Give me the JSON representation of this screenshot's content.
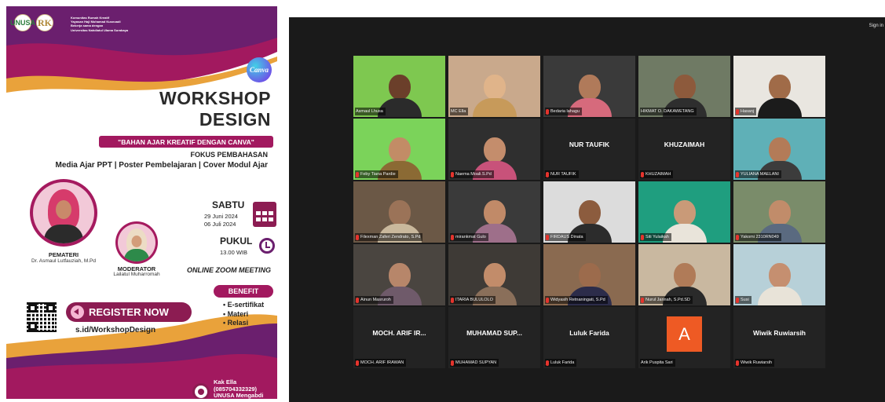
{
  "poster": {
    "logos": [
      "UNUSA",
      "RK"
    ],
    "org_lines": [
      "Komunitas Rumah Kreatif",
      "Yayasan Haji Mohamad Kusnoadi",
      "Bekerja sama dengan",
      "Universitas Nahdlatul Ulama Surabaya"
    ],
    "canva_badge": "Canva",
    "title_line1": "WORKSHOP",
    "title_line2": "DESIGN",
    "subtitle": "\"BAHAN AJAR KREATIF DENGAN CANVA\"",
    "fokus_label": "FOKUS PEMBAHASAN",
    "topics": "Media Ajar PPT | Poster Pembelajaran | Cover Modul Ajar",
    "pemateri_role": "PEMATERI",
    "pemateri_name": "Dr. Asmaul Lutfauziah, M.Pd",
    "moderator_role": "MODERATOR",
    "moderator_name": "Lailatul Muharromah",
    "day": "SABTU",
    "date1": "29 Juni 2024",
    "date2": "06 Juli 2024",
    "pukul_label": "PUKUL",
    "time": "13.00 WIB",
    "meeting": "ONLINE ZOOM MEETING",
    "benefit_label": "BENEFIT",
    "benefits": [
      "• E-sertifikat",
      "• Materi",
      "• Relasi"
    ],
    "register_label": "REGISTER NOW",
    "register_link": "s.id/WorkshopDesign",
    "contact_name": "Kak Ella",
    "contact_phone": "(085704332329)",
    "contact_org": "UNUSA Mengabdi",
    "colors": {
      "magenta": "#a2195f",
      "purple": "#6b1f6e",
      "dark_magenta": "#8c1c52"
    }
  },
  "zoom": {
    "sign_in": "Sign in",
    "participants": [
      {
        "name": "Asmaul Lhusa",
        "muted": false,
        "big_name": "",
        "bg": "#7ec850",
        "skin": "#6b3f2a",
        "cloth": "#2b2b2b",
        "active": false
      },
      {
        "name": "MC Ella",
        "muted": false,
        "big_name": "",
        "bg": "#c9a98c",
        "skin": "#e0b48a",
        "cloth": "#c79a5a",
        "active": true
      },
      {
        "name": "Bedaria lahagu",
        "muted": true,
        "big_name": "",
        "bg": "#3a3a3a",
        "skin": "#b07a5a",
        "cloth": "#d66a7c",
        "active": false
      },
      {
        "name": "HIKMAT O. DAKAWETANG",
        "muted": false,
        "big_name": "",
        "bg": "#6f7a64",
        "skin": "#8d5a3c",
        "cloth": "#2e2e2e",
        "active": false
      },
      {
        "name": "Hasanj",
        "muted": true,
        "big_name": "",
        "bg": "#e9e6e0",
        "skin": "#a06b48",
        "cloth": "#1b1b1b",
        "active": false
      },
      {
        "name": "Feby Tiana Pardie",
        "muted": true,
        "big_name": "",
        "bg": "#7bd35a",
        "skin": "#c28c66",
        "cloth": "#8b6a34",
        "active": false
      },
      {
        "name": "Naema Moali.S.Pd",
        "muted": true,
        "big_name": "",
        "bg": "#2f2f2f",
        "skin": "#c48d6c",
        "cloth": "#c8527a",
        "active": false
      },
      {
        "name": "NUR TAUFIK",
        "muted": true,
        "big_name": "NUR TAUFIK",
        "bg": "#232323",
        "skin": "",
        "cloth": "",
        "active": false
      },
      {
        "name": "KHUZAIMAH",
        "muted": true,
        "big_name": "KHUZAIMAH",
        "bg": "#232323",
        "skin": "",
        "cloth": "",
        "active": false
      },
      {
        "name": "YULIANA MAELANI",
        "muted": true,
        "big_name": "",
        "bg": "#5fb0b7",
        "skin": "#b37b58",
        "cloth": "#3c3c3c",
        "active": false
      },
      {
        "name": "Filexman Zaferi Zendrato, S.Pd",
        "muted": true,
        "big_name": "",
        "bg": "#6b5846",
        "skin": "#9b7358",
        "cloth": "#c9b89c",
        "active": false
      },
      {
        "name": "mirankmat Gulo",
        "muted": true,
        "big_name": "",
        "bg": "#3a3a3a",
        "skin": "#c18a68",
        "cloth": "#9e6f8a",
        "active": false
      },
      {
        "name": "FIRDAUS Dinata",
        "muted": true,
        "big_name": "",
        "bg": "#dcdcdc",
        "skin": "#8c5c3e",
        "cloth": "#2c2c2c",
        "active": false
      },
      {
        "name": "Siti Yulaikah",
        "muted": true,
        "big_name": "",
        "bg": "#1f9e7f",
        "skin": "#c99a78",
        "cloth": "#e9e4da",
        "active": false
      },
      {
        "name": "Yakomi 2310RN049",
        "muted": true,
        "big_name": "",
        "bg": "#7a8c6a",
        "skin": "#c18c6a",
        "cloth": "#5a6a80",
        "active": false
      },
      {
        "name": "Ainun Masruroh",
        "muted": true,
        "big_name": "",
        "bg": "#4a4540",
        "skin": "#b7866a",
        "cloth": "#6f5a6a",
        "active": false
      },
      {
        "name": "ITARIA BULULOLO",
        "muted": true,
        "big_name": "",
        "bg": "#3e3a36",
        "skin": "#c28c6a",
        "cloth": "#8a6f5a",
        "active": false
      },
      {
        "name": "Widyasih Retnaningati, S.Pd",
        "muted": true,
        "big_name": "",
        "bg": "#8a6a50",
        "skin": "#9c6b4c",
        "cloth": "#2c2c4a",
        "active": false
      },
      {
        "name": "Nurul Jannah, S.Pd.SD",
        "muted": true,
        "big_name": "",
        "bg": "#c9b8a0",
        "skin": "#b07b58",
        "cloth": "#2a2a2a",
        "active": false
      },
      {
        "name": "Susi",
        "muted": true,
        "big_name": "",
        "bg": "#b7d0d8",
        "skin": "#c58f70",
        "cloth": "#e8e3d8",
        "active": false
      },
      {
        "name": "MOCH. ARIF IRAWAN",
        "muted": true,
        "big_name": "MOCH. ARIF IR...",
        "bg": "#232323",
        "skin": "",
        "cloth": "",
        "active": false
      },
      {
        "name": "MUHAMAD SUPYAN",
        "muted": true,
        "big_name": "MUHAMAD SUP...",
        "bg": "#232323",
        "skin": "",
        "cloth": "",
        "active": false
      },
      {
        "name": "Luluk Farida",
        "muted": true,
        "big_name": "Luluk Farida",
        "bg": "#232323",
        "skin": "",
        "cloth": "",
        "active": false
      },
      {
        "name": "Arik Puspita Sari",
        "muted": false,
        "big_name": "",
        "avatar": "A",
        "bg": "#232323",
        "skin": "",
        "cloth": "",
        "active": false
      },
      {
        "name": "Wiwik Ruwiarsih",
        "muted": true,
        "big_name": "Wiwik Ruwiarsih",
        "bg": "#232323",
        "skin": "",
        "cloth": "",
        "active": false
      }
    ]
  }
}
